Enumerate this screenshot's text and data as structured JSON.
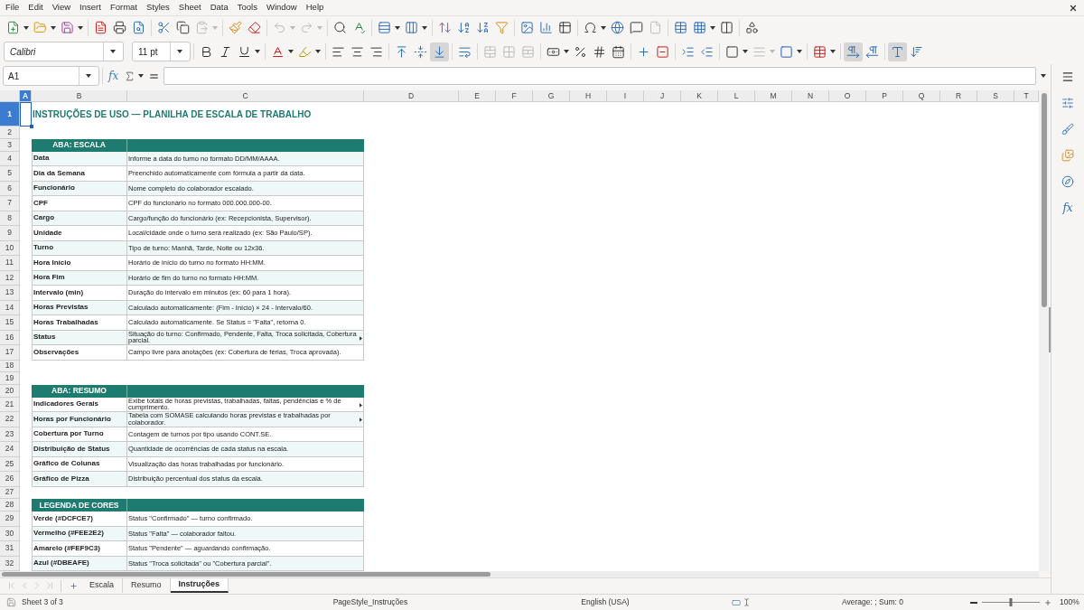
{
  "menu_bar": {
    "items": [
      "File",
      "Edit",
      "View",
      "Insert",
      "Format",
      "Styles",
      "Sheet",
      "Data",
      "Tools",
      "Window",
      "Help"
    ]
  },
  "standard_toolbar": {
    "groups": [
      [
        {
          "kind": "new",
          "disabled": false
        },
        {
          "kind": "open",
          "disabled": false
        },
        {
          "kind": "save",
          "disabled": false
        }
      ],
      [
        {
          "kind": "pdf",
          "disabled": false
        },
        {
          "kind": "print",
          "disabled": false
        },
        {
          "kind": "preview",
          "disabled": false
        }
      ],
      [
        {
          "kind": "cut",
          "disabled": false
        },
        {
          "kind": "copy",
          "disabled": false
        },
        {
          "kind": "paste",
          "disabled": true
        }
      ],
      [
        {
          "kind": "clone",
          "disabled": false
        },
        {
          "kind": "clear",
          "disabled": false
        }
      ],
      [
        {
          "kind": "undo",
          "disabled": true
        },
        {
          "kind": "redo",
          "disabled": true
        }
      ],
      [
        {
          "kind": "find",
          "disabled": false
        },
        {
          "kind": "spelling",
          "disabled": false
        }
      ],
      [
        {
          "kind": "rows",
          "disabled": false
        },
        {
          "kind": "columns",
          "disabled": false
        }
      ],
      [
        {
          "kind": "sort",
          "disabled": false
        },
        {
          "kind": "ascending",
          "disabled": false
        },
        {
          "kind": "descending",
          "disabled": false
        },
        {
          "kind": "filter",
          "disabled": false
        }
      ],
      [
        {
          "kind": "image",
          "disabled": false
        },
        {
          "kind": "chart",
          "disabled": false
        },
        {
          "kind": "pivot",
          "disabled": false
        }
      ],
      [
        {
          "kind": "symbol",
          "disabled": false
        },
        {
          "kind": "link",
          "disabled": false
        },
        {
          "kind": "comment",
          "disabled": false
        },
        {
          "kind": "headers",
          "disabled": true
        }
      ],
      [
        {
          "kind": "printarea",
          "disabled": false
        },
        {
          "kind": "freeze",
          "disabled": false
        },
        {
          "kind": "split",
          "disabled": false
        }
      ],
      [
        {
          "kind": "shapes",
          "disabled": false
        }
      ]
    ]
  },
  "formatting_toolbar": {
    "font_name": "Calibri",
    "font_size": "11 pt",
    "groups": [
      [
        {
          "kind": "bold",
          "disabled": false,
          "pressed": false
        },
        {
          "kind": "italic",
          "disabled": false,
          "pressed": false
        },
        {
          "kind": "underline",
          "disabled": false,
          "pressed": false
        }
      ],
      [
        {
          "kind": "fontcolor",
          "disabled": false,
          "pressed": false
        },
        {
          "kind": "highlight",
          "disabled": false,
          "pressed": false
        }
      ],
      [
        {
          "kind": "left",
          "disabled": false,
          "pressed": false
        },
        {
          "kind": "center",
          "disabled": false,
          "pressed": false
        },
        {
          "kind": "right",
          "disabled": false,
          "pressed": false
        }
      ],
      [
        {
          "kind": "top",
          "disabled": false,
          "pressed": false
        },
        {
          "kind": "middle",
          "disabled": false,
          "pressed": false
        },
        {
          "kind": "bottom",
          "disabled": false,
          "pressed": true
        }
      ],
      [
        {
          "kind": "wrap",
          "disabled": false,
          "pressed": false
        }
      ],
      [
        {
          "kind": "mergecenter",
          "disabled": true,
          "pressed": false
        },
        {
          "kind": "merge",
          "disabled": true,
          "pressed": false
        },
        {
          "kind": "unmerge",
          "disabled": true,
          "pressed": false
        }
      ],
      [
        {
          "kind": "currency",
          "disabled": false,
          "pressed": false
        },
        {
          "kind": "percent",
          "disabled": false,
          "pressed": false
        },
        {
          "kind": "number",
          "disabled": false,
          "pressed": false
        },
        {
          "kind": "date",
          "disabled": false,
          "pressed": false
        }
      ],
      [
        {
          "kind": "adddecimal",
          "disabled": false,
          "pressed": false
        },
        {
          "kind": "deldecimal",
          "disabled": false,
          "pressed": false
        }
      ],
      [
        {
          "kind": "indent",
          "disabled": false,
          "pressed": false
        },
        {
          "kind": "outdent",
          "disabled": false,
          "pressed": false
        }
      ],
      [
        {
          "kind": "borders",
          "disabled": false,
          "pressed": false
        },
        {
          "kind": "borderstyle",
          "disabled": true,
          "pressed": false
        },
        {
          "kind": "bordercolor",
          "disabled": false,
          "pressed": false
        }
      ],
      [
        {
          "kind": "conditional",
          "disabled": false,
          "pressed": false
        }
      ],
      [
        {
          "kind": "ltr",
          "disabled": false,
          "pressed": true
        },
        {
          "kind": "rtl",
          "disabled": false,
          "pressed": false
        }
      ],
      [
        {
          "kind": "stacked",
          "disabled": false,
          "pressed": true
        },
        {
          "kind": "vertical",
          "disabled": false,
          "pressed": false
        }
      ]
    ]
  },
  "formula_bar": {
    "name_box": "A1",
    "function_wizard": "fx"
  },
  "sheet": {
    "columns": [
      {
        "label": "A",
        "selected": true
      },
      {
        "label": "B",
        "selected": false
      },
      {
        "label": "C",
        "selected": false
      },
      {
        "label": "D",
        "selected": false
      },
      {
        "label": "E",
        "selected": false
      },
      {
        "label": "F",
        "selected": false
      },
      {
        "label": "G",
        "selected": false
      },
      {
        "label": "H",
        "selected": false
      },
      {
        "label": "I",
        "selected": false
      },
      {
        "label": "J",
        "selected": false
      },
      {
        "label": "K",
        "selected": false
      },
      {
        "label": "L",
        "selected": false
      },
      {
        "label": "M",
        "selected": false
      },
      {
        "label": "N",
        "selected": false
      },
      {
        "label": "O",
        "selected": false
      },
      {
        "label": "P",
        "selected": false
      },
      {
        "label": "Q",
        "selected": false
      },
      {
        "label": "R",
        "selected": false
      },
      {
        "label": "S",
        "selected": false
      },
      {
        "label": "T",
        "selected": false
      }
    ],
    "rows": [
      {
        "number": "1",
        "selected": true,
        "kind": "title",
        "text": "INSTRUÇÕES DE USO — PLANILHA DE ESCALA DE TRABALHO"
      },
      {
        "number": "2",
        "selected": false,
        "kind": "blank"
      },
      {
        "number": "3",
        "selected": false,
        "kind": "header",
        "label": "ABA: ESCALA"
      },
      {
        "number": "4",
        "selected": false,
        "kind": "entry",
        "label": "Data",
        "description": "Informe a data do turno no formato DD/MM/AAAA.",
        "overflow": false
      },
      {
        "number": "5",
        "selected": false,
        "kind": "entry",
        "label": "Dia da Semana",
        "description": "Preenchido automaticamente com fórmula a partir da data.",
        "overflow": false
      },
      {
        "number": "6",
        "selected": false,
        "kind": "entry",
        "label": "Funcionário",
        "description": "Nome completo do colaborador escalado.",
        "overflow": false
      },
      {
        "number": "7",
        "selected": false,
        "kind": "entry",
        "label": "CPF",
        "description": "CPF do funcionário no formato 000.000.000-00.",
        "overflow": false
      },
      {
        "number": "8",
        "selected": false,
        "kind": "entry",
        "label": "Cargo",
        "description": "Cargo/função do funcionário (ex: Recepcionista, Supervisor).",
        "overflow": false
      },
      {
        "number": "9",
        "selected": false,
        "kind": "entry",
        "label": "Unidade",
        "description": "Local/cidade onde o turno será realizado (ex: São Paulo/SP).",
        "overflow": false
      },
      {
        "number": "10",
        "selected": false,
        "kind": "entry",
        "label": "Turno",
        "description": "Tipo de turno: Manhã, Tarde, Noite ou 12x36.",
        "overflow": false
      },
      {
        "number": "11",
        "selected": false,
        "kind": "entry",
        "label": "Hora Início",
        "description": "Horário de início do turno no formato HH:MM.",
        "overflow": false
      },
      {
        "number": "12",
        "selected": false,
        "kind": "entry",
        "label": "Hora Fim",
        "description": "Horário de fim do turno no formato HH:MM.",
        "overflow": false
      },
      {
        "number": "13",
        "selected": false,
        "kind": "entry",
        "label": "Intervalo (min)",
        "description": "Duração do intervalo em minutos (ex: 60 para 1 hora).",
        "overflow": false
      },
      {
        "number": "14",
        "selected": false,
        "kind": "entry",
        "label": "Horas Previstas",
        "description": "Calculado automaticamente: (Fim - Início) × 24 - Intervalo/60.",
        "overflow": false
      },
      {
        "number": "15",
        "selected": false,
        "kind": "entry",
        "label": "Horas Trabalhadas",
        "description": "Calculado automaticamente. Se Status = \"Falta\", retorna 0.",
        "overflow": false
      },
      {
        "number": "16",
        "selected": false,
        "kind": "entry",
        "label": "Status",
        "description": "Situação do turno: Confirmado, Pendente, Falta, Troca solicitada, Cobertura parcial.",
        "overflow": true
      },
      {
        "number": "17",
        "selected": false,
        "kind": "entry",
        "label": "Observações",
        "description": "Campo livre para anotações (ex: Cobertura de férias, Troca aprovada).",
        "overflow": false
      },
      {
        "number": "18",
        "selected": false,
        "kind": "blank"
      },
      {
        "number": "19",
        "selected": false,
        "kind": "blank"
      },
      {
        "number": "20",
        "selected": false,
        "kind": "header",
        "label": "ABA: RESUMO"
      },
      {
        "number": "21",
        "selected": false,
        "kind": "entry",
        "label": "Indicadores Gerais",
        "description": "Exibe totais de horas previstas, trabalhadas, faltas, pendências e % de cumprimento.",
        "overflow": true
      },
      {
        "number": "22",
        "selected": false,
        "kind": "entry",
        "label": "Horas por Funcionário",
        "description": "Tabela com SOMASE calculando horas previstas e trabalhadas por colaborador.",
        "overflow": true
      },
      {
        "number": "23",
        "selected": false,
        "kind": "entry",
        "label": "Cobertura por Turno",
        "description": "Contagem de turnos por tipo usando CONT.SE.",
        "overflow": false
      },
      {
        "number": "24",
        "selected": false,
        "kind": "entry",
        "label": "Distribuição de Status",
        "description": "Quantidade de ocorrências de cada status na escala.",
        "overflow": false
      },
      {
        "number": "25",
        "selected": false,
        "kind": "entry",
        "label": "Gráfico de Colunas",
        "description": "Visualização das horas trabalhadas por funcionário.",
        "overflow": false
      },
      {
        "number": "26",
        "selected": false,
        "kind": "entry",
        "label": "Gráfico de Pizza",
        "description": "Distribuição percentual dos status da escala.",
        "overflow": false
      },
      {
        "number": "27",
        "selected": false,
        "kind": "blank"
      },
      {
        "number": "28",
        "selected": false,
        "kind": "header",
        "label": "LEGENDA DE CORES"
      },
      {
        "number": "29",
        "selected": false,
        "kind": "entry",
        "label": "Verde (#DCFCE7)",
        "description": "Status \"Confirmado\" — turno confirmado.",
        "overflow": false
      },
      {
        "number": "30",
        "selected": false,
        "kind": "entry",
        "label": "Vermelho (#FEE2E2)",
        "description": "Status \"Falta\" — colaborador faltou.",
        "overflow": false
      },
      {
        "number": "31",
        "selected": false,
        "kind": "entry",
        "label": "Amarelo (#FEF9C3)",
        "description": "Status \"Pendente\" — aguardando confirmação.",
        "overflow": false
      },
      {
        "number": "32",
        "selected": false,
        "kind": "entry",
        "label": "Azul (#DBEAFE)",
        "description": "Status \"Troca solicitada\" ou \"Cobertura parcial\".",
        "overflow": false
      }
    ]
  },
  "sheet_tabs": [
    {
      "label": "Escala",
      "selected": false
    },
    {
      "label": "Resumo",
      "selected": false
    },
    {
      "label": "Instruções",
      "selected": true
    }
  ],
  "sidebar": {
    "functions_tab": "fx"
  },
  "status_bar": {
    "sheet": "Sheet 3 of 3",
    "page_style": "PageStyle_Instruções",
    "language": "English (USA)",
    "summary": "Average: ; Sum: 0",
    "zoom": {
      "level": 0.5,
      "reading": "100%"
    }
  }
}
